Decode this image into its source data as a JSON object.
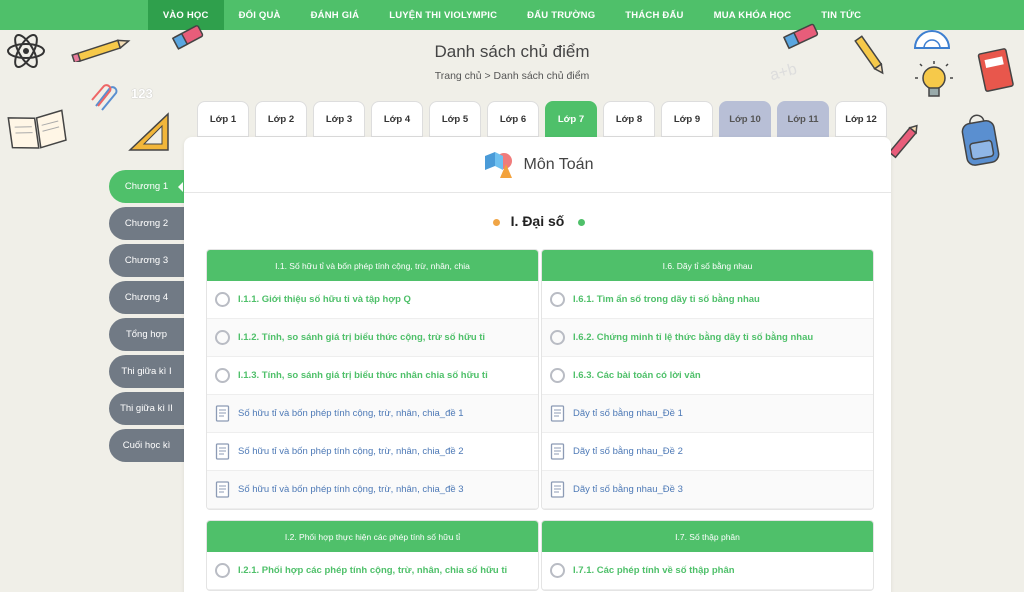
{
  "nav": {
    "items": [
      {
        "label": "VÀO HỌC",
        "active": true
      },
      {
        "label": "ĐỔI QUÀ",
        "active": false
      },
      {
        "label": "ĐÁNH GIÁ",
        "active": false
      },
      {
        "label": "LUYỆN THI VIOLYMPIC",
        "active": false
      },
      {
        "label": "ĐẤU TRƯỜNG",
        "active": false
      },
      {
        "label": "THÁCH ĐẤU",
        "active": false
      },
      {
        "label": "MUA KHÓA HỌC",
        "active": false
      },
      {
        "label": "TIN TỨC",
        "active": false
      }
    ]
  },
  "header": {
    "title": "Danh sách chủ điểm",
    "breadcrumb": "Trang chủ > Danh sách chủ điểm"
  },
  "grades": [
    {
      "label": "Lớp 1",
      "state": "normal"
    },
    {
      "label": "Lớp 2",
      "state": "normal"
    },
    {
      "label": "Lớp 3",
      "state": "normal"
    },
    {
      "label": "Lớp 4",
      "state": "normal"
    },
    {
      "label": "Lớp 5",
      "state": "normal"
    },
    {
      "label": "Lớp 6",
      "state": "normal"
    },
    {
      "label": "Lớp 7",
      "state": "active"
    },
    {
      "label": "Lớp 8",
      "state": "normal"
    },
    {
      "label": "Lớp 9",
      "state": "normal"
    },
    {
      "label": "Lớp 10",
      "state": "disabled"
    },
    {
      "label": "Lớp 11",
      "state": "disabled"
    },
    {
      "label": "Lớp 12",
      "state": "normal"
    }
  ],
  "subject": {
    "title": "Môn Toán",
    "icon": "math-shapes-icon"
  },
  "section": {
    "title": "I. Đại số",
    "dot_left_color": "#f0a546",
    "dot_right_color": "#4fc06a"
  },
  "chapters": [
    {
      "label": "Chương 1",
      "active": true
    },
    {
      "label": "Chương 2",
      "active": false
    },
    {
      "label": "Chương 3",
      "active": false
    },
    {
      "label": "Chương 4",
      "active": false
    },
    {
      "label": "Tổng hợp",
      "active": false
    },
    {
      "label": "Thi giữa kì I",
      "active": false
    },
    {
      "label": "Thi giữa kì II",
      "active": false
    },
    {
      "label": "Cuối học kì",
      "active": false
    }
  ],
  "panels": [
    {
      "title": "I.1. Số hữu tỉ và bốn phép tính cộng, trừ, nhân, chia",
      "rows": [
        {
          "type": "lesson",
          "label": "I.1.1. Giới thiệu số hữu tỉ và tập hợp Q"
        },
        {
          "type": "lesson",
          "label": "I.1.2. Tính, so sánh giá trị biểu thức cộng, trừ số hữu tỉ"
        },
        {
          "type": "lesson",
          "label": "I.1.3. Tính, so sánh giá trị biểu thức nhân chia số hữu tỉ"
        },
        {
          "type": "exam",
          "label": "Số hữu tỉ và bốn phép tính cộng, trừ, nhân, chia_đề 1"
        },
        {
          "type": "exam",
          "label": "Số hữu tỉ và bốn phép tính cộng, trừ, nhân, chia_đề 2"
        },
        {
          "type": "exam",
          "label": "Số hữu tỉ và bốn phép tính cộng, trừ, nhân, chia_đề 3"
        }
      ]
    },
    {
      "title": "I.6. Dãy tỉ số bằng nhau",
      "rows": [
        {
          "type": "lesson",
          "label": "I.6.1. Tìm ẩn số trong dãy tỉ số bằng nhau"
        },
        {
          "type": "lesson",
          "label": "I.6.2. Chứng minh tỉ lệ thức bằng dãy tỉ số bằng nhau"
        },
        {
          "type": "lesson",
          "label": "I.6.3. Các bài toán có lời văn"
        },
        {
          "type": "exam",
          "label": "Dãy tỉ số bằng nhau_Đề 1"
        },
        {
          "type": "exam",
          "label": "Dãy tỉ số bằng nhau_Đề 2"
        },
        {
          "type": "exam",
          "label": "Dãy tỉ số bằng nhau_Đề 3"
        }
      ]
    },
    {
      "title": "I.2. Phối hợp thực hiện các phép tính số hữu tỉ",
      "rows": [
        {
          "type": "lesson",
          "label": "I.2.1. Phối hợp các phép tính cộng, trừ, nhân, chia số hữu tỉ"
        }
      ]
    },
    {
      "title": "I.7. Số thập phân",
      "rows": [
        {
          "type": "lesson",
          "label": "I.7.1. Các phép tính về số thập phân"
        }
      ]
    }
  ],
  "decor": {
    "numbers_text": "123",
    "formula_text": "a+b"
  }
}
